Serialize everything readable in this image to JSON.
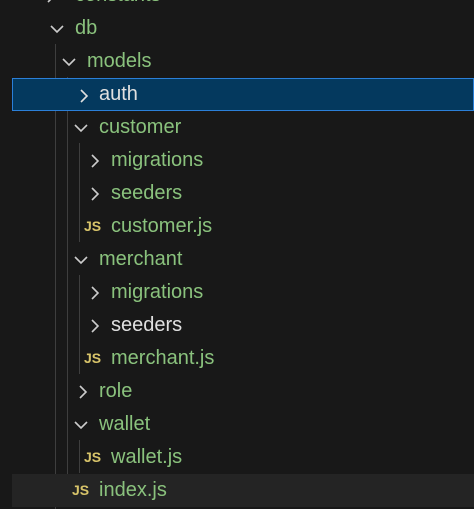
{
  "explorer": {
    "items": [
      {
        "label": "constants",
        "type": "folder",
        "expanded": false,
        "color": "green"
      },
      {
        "label": "db",
        "type": "folder",
        "expanded": true,
        "color": "green"
      },
      {
        "label": "models",
        "type": "folder",
        "expanded": true,
        "color": "green"
      },
      {
        "label": "auth",
        "type": "folder",
        "expanded": false,
        "color": "white",
        "selected": true
      },
      {
        "label": "customer",
        "type": "folder",
        "expanded": true,
        "color": "green"
      },
      {
        "label": "migrations",
        "type": "folder",
        "expanded": false,
        "color": "green"
      },
      {
        "label": "seeders",
        "type": "folder",
        "expanded": false,
        "color": "green"
      },
      {
        "label": "customer.js",
        "type": "file",
        "icon": "JS",
        "color": "green"
      },
      {
        "label": "merchant",
        "type": "folder",
        "expanded": true,
        "color": "green"
      },
      {
        "label": "migrations",
        "type": "folder",
        "expanded": false,
        "color": "green"
      },
      {
        "label": "seeders",
        "type": "folder",
        "expanded": false,
        "color": "white"
      },
      {
        "label": "merchant.js",
        "type": "file",
        "icon": "JS",
        "color": "green"
      },
      {
        "label": "role",
        "type": "folder",
        "expanded": false,
        "color": "green"
      },
      {
        "label": "wallet",
        "type": "folder",
        "expanded": true,
        "color": "green"
      },
      {
        "label": "wallet.js",
        "type": "file",
        "icon": "JS",
        "color": "green"
      },
      {
        "label": "index.js",
        "type": "file",
        "icon": "JS",
        "color": "green",
        "hovered": true
      }
    ],
    "colors": {
      "background": "#181818",
      "green": "#8ac27d",
      "white": "#e0e0e0",
      "js_icon": "#d8c46a",
      "selection_bg": "#04395e",
      "selection_border": "#2b7fd8"
    }
  }
}
